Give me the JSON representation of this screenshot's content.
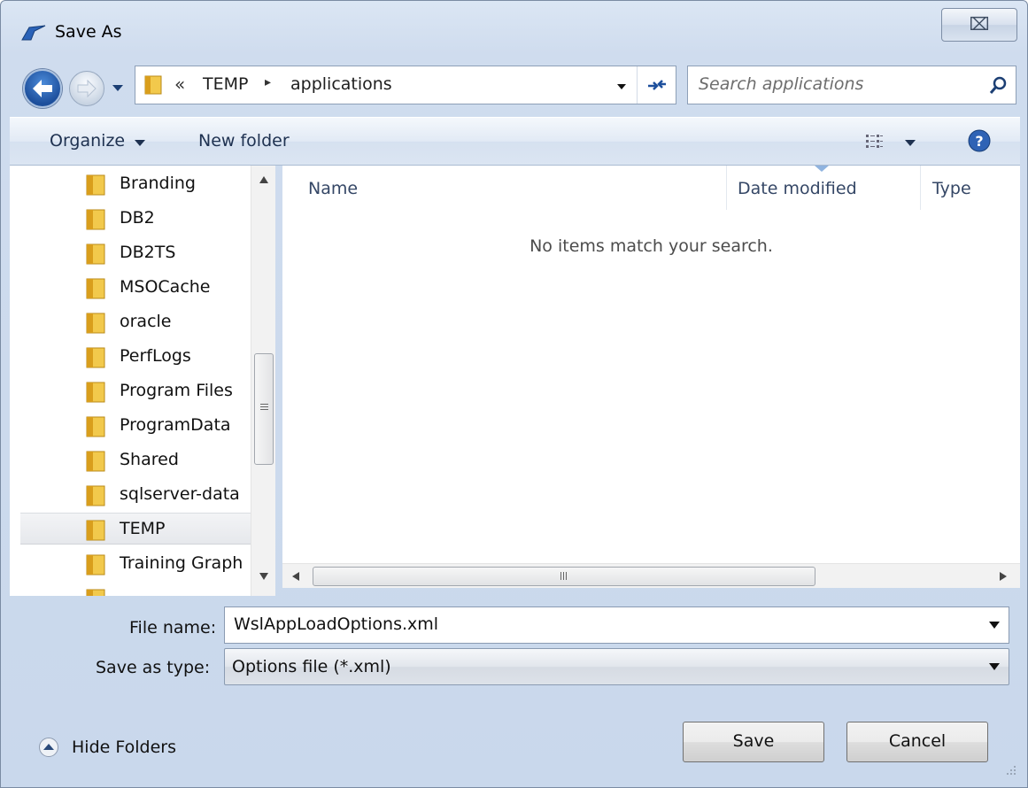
{
  "window": {
    "title": "Save As",
    "close_glyph": "⌧"
  },
  "address": {
    "overflow_chevron": "«",
    "breadcrumbs": [
      "TEMP",
      "applications"
    ],
    "separator": "▸"
  },
  "search": {
    "placeholder": "Search applications",
    "value": ""
  },
  "toolbar": {
    "organize_label": "Organize",
    "new_folder_label": "New folder"
  },
  "nav_pane": {
    "items": [
      {
        "label": "Branding",
        "selected": false
      },
      {
        "label": "DB2",
        "selected": false
      },
      {
        "label": "DB2TS",
        "selected": false
      },
      {
        "label": "MSOCache",
        "selected": false
      },
      {
        "label": "oracle",
        "selected": false
      },
      {
        "label": "PerfLogs",
        "selected": false
      },
      {
        "label": "Program Files",
        "selected": false
      },
      {
        "label": "ProgramData",
        "selected": false
      },
      {
        "label": "Shared",
        "selected": false
      },
      {
        "label": "sqlserver-data",
        "selected": false
      },
      {
        "label": "TEMP",
        "selected": true
      },
      {
        "label": "Training Graph",
        "selected": false
      }
    ]
  },
  "file_list": {
    "columns": [
      "Name",
      "Date modified",
      "Type"
    ],
    "empty_message": "No items match your search."
  },
  "form": {
    "file_name_label": "File name:",
    "file_name_value": "WslAppLoadOptions.xml",
    "save_type_label": "Save as type:",
    "save_type_value": "Options file (*.xml)"
  },
  "footer": {
    "hide_folders_label": "Hide Folders",
    "save_label": "Save",
    "cancel_label": "Cancel"
  },
  "colors": {
    "accent_blue": "#1d4f9c",
    "folder_yellow": "#e8b631",
    "toolbar_text": "#1e3150"
  },
  "icons": [
    "title-arrow-icon",
    "back-arrow-icon",
    "forward-arrow-icon",
    "folder-icon",
    "refresh-icon",
    "search-icon",
    "view-options-icon",
    "help-icon",
    "collapse-icon",
    "resize-grip-icon"
  ]
}
